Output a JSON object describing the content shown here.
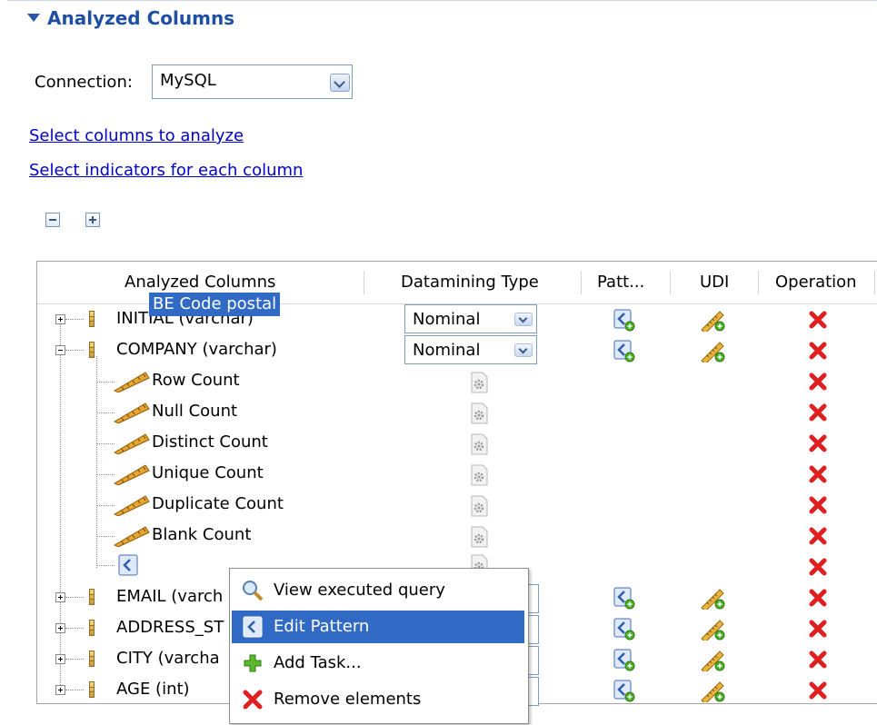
{
  "section": {
    "title": "Analyzed Columns"
  },
  "connection": {
    "label": "Connection:",
    "value": "MySQL"
  },
  "links": {
    "select_columns": "Select columns to analyze",
    "select_indicators": "Select indicators for each column"
  },
  "table": {
    "headers": [
      "Analyzed Columns",
      "Datamining Type",
      "Patt...",
      "UDI",
      "Operation"
    ],
    "rows": [
      {
        "label": "INITIAL (varchar)",
        "datamining_type": "Nominal"
      },
      {
        "label": "COMPANY (varchar)",
        "datamining_type": "Nominal"
      },
      {
        "label": "EMAIL (varch"
      },
      {
        "label": "ADDRESS_ST"
      },
      {
        "label": "CITY (varcha"
      },
      {
        "label": "AGE (int)"
      }
    ],
    "indicators": [
      "Row Count",
      "Null Count",
      "Distinct Count",
      "Unique Count",
      "Duplicate Count",
      "Blank Count"
    ],
    "pattern_item": "BE Code postal"
  },
  "context_menu": {
    "items": [
      "View executed query",
      "Edit Pattern",
      "Add Task...",
      "Remove elements"
    ],
    "highlighted_index": 1
  },
  "colors": {
    "accent": "#316ac5",
    "title": "#1f4fa3",
    "link": "#0000cc",
    "delete": "#e02020"
  }
}
